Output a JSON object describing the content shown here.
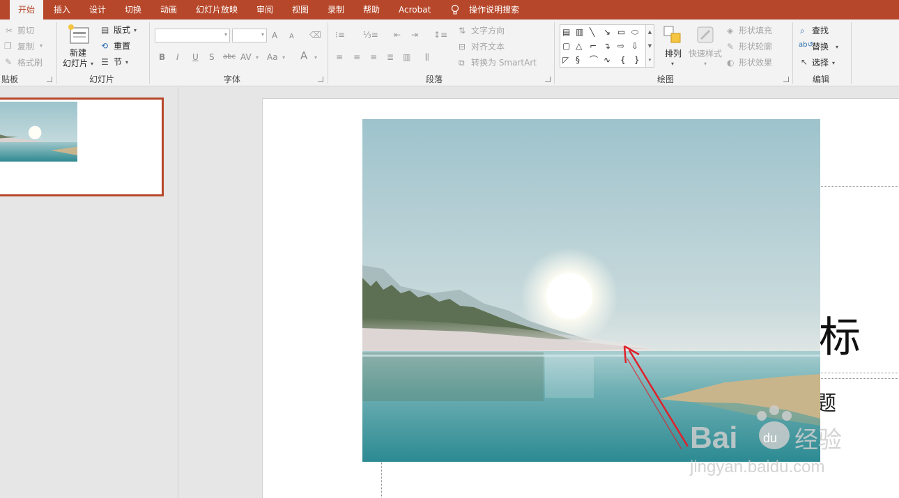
{
  "tabs": [
    {
      "label": "开始",
      "active": true
    },
    {
      "label": "插入"
    },
    {
      "label": "设计"
    },
    {
      "label": "切换"
    },
    {
      "label": "动画"
    },
    {
      "label": "幻灯片放映"
    },
    {
      "label": "审阅"
    },
    {
      "label": "视图"
    },
    {
      "label": "录制"
    },
    {
      "label": "帮助"
    },
    {
      "label": "Acrobat"
    },
    {
      "label": "操作说明搜索"
    }
  ],
  "clipboard": {
    "cut": "剪切",
    "copy": "复制",
    "format_painter": "格式刷",
    "group": "贴板"
  },
  "slides": {
    "new_slide_line1": "新建",
    "new_slide_line2": "幻灯片",
    "layout": "版式",
    "reset": "重置",
    "section": "节",
    "group": "幻灯片"
  },
  "font": {
    "group": "字体",
    "bold": "B",
    "italic": "I",
    "underline": "U",
    "shadow": "S",
    "strike": "abc",
    "spacing": "AV",
    "case": "Aa",
    "color": "A",
    "grow": "A",
    "shrink": "A"
  },
  "paragraph": {
    "text_direction": "文字方向",
    "align_text": "对齐文本",
    "smartart": "转换为 SmartArt",
    "group": "段落"
  },
  "drawing": {
    "arrange": "排列",
    "quick_styles": "快速样式",
    "shape_fill": "形状填充",
    "shape_outline": "形状轮廓",
    "shape_effects": "形状效果",
    "group": "绘图"
  },
  "editing": {
    "find": "查找",
    "replace": "替换",
    "select": "选择",
    "group": "编辑"
  },
  "slide": {
    "title": "添加标",
    "subtitle": "添加副标题"
  },
  "watermark": {
    "logo": "Bai du 经验",
    "url": "jingyan.baidu.com"
  },
  "colors": {
    "accent": "#b7472a",
    "arrow": "#e0202a"
  }
}
